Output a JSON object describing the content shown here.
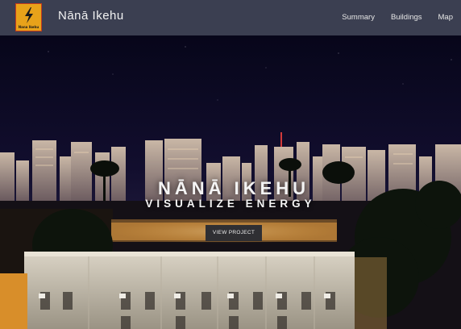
{
  "brand": {
    "logo_text": "Nana Ikehu",
    "title": "Nānā Ikehu"
  },
  "nav": {
    "links": [
      "Summary",
      "Buildings",
      "Map"
    ]
  },
  "hero": {
    "title": "NĀNĀ IKEHU",
    "subtitle": "VISUALIZE ENERGY",
    "button_label": "VIEW PROJECT"
  },
  "colors": {
    "navbar": "#3b3f51",
    "logo_bg": "#e8a21a",
    "night_sky": "#0c0a1c",
    "building_facade": "#d9d1bf",
    "window_glow": "#e3a03a"
  },
  "icons": {
    "logo": "lightning-bolt-icon"
  }
}
